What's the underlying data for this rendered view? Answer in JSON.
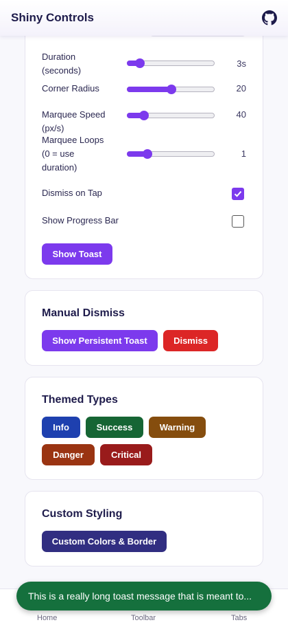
{
  "app": {
    "title": "Shiny Controls"
  },
  "config_card": {
    "sliders": [
      {
        "label_lines": [
          "Duration",
          "(seconds)"
        ],
        "value_text": "3s",
        "level": 0.14
      },
      {
        "label_lines": [
          "Corner Radius"
        ],
        "value_text": "20",
        "level": 0.5
      },
      {
        "label_lines": [
          "Marquee Speed",
          "(px/s)"
        ],
        "value_text": "40",
        "level": 0.19
      },
      {
        "label_lines": [
          "Marquee Loops",
          "(0 = use",
          "duration)"
        ],
        "value_text": "1",
        "level": 0.23
      }
    ],
    "dismiss_on_tap": {
      "label": "Dismiss on Tap",
      "checked": true
    },
    "show_progress_bar": {
      "label": "Show Progress Bar",
      "checked": false
    },
    "show_toast_label": "Show Toast"
  },
  "manual_dismiss": {
    "title": "Manual Dismiss",
    "persistent_label": "Show Persistent Toast",
    "dismiss_label": "Dismiss"
  },
  "themed_types": {
    "title": "Themed Types",
    "buttons": [
      {
        "label": "Info",
        "color": "#1e40af"
      },
      {
        "label": "Success",
        "color": "#166534"
      },
      {
        "label": "Warning",
        "color": "#854d0e"
      },
      {
        "label": "Danger",
        "color": "#9a3412"
      },
      {
        "label": "Critical",
        "color": "#991b1b"
      }
    ]
  },
  "custom_styling": {
    "title": "Custom Styling",
    "button_label": "Custom Colors & Border",
    "button_color": "#312e81"
  },
  "colors": {
    "accent": "#7c3aed",
    "toast": "#15703d",
    "danger": "#dc2626"
  },
  "tabs": [
    {
      "label": "Home"
    },
    {
      "label": "Toolbar"
    },
    {
      "label": "Tabs"
    }
  ],
  "toast": {
    "message": "This is a really long toast message that is meant to..."
  }
}
